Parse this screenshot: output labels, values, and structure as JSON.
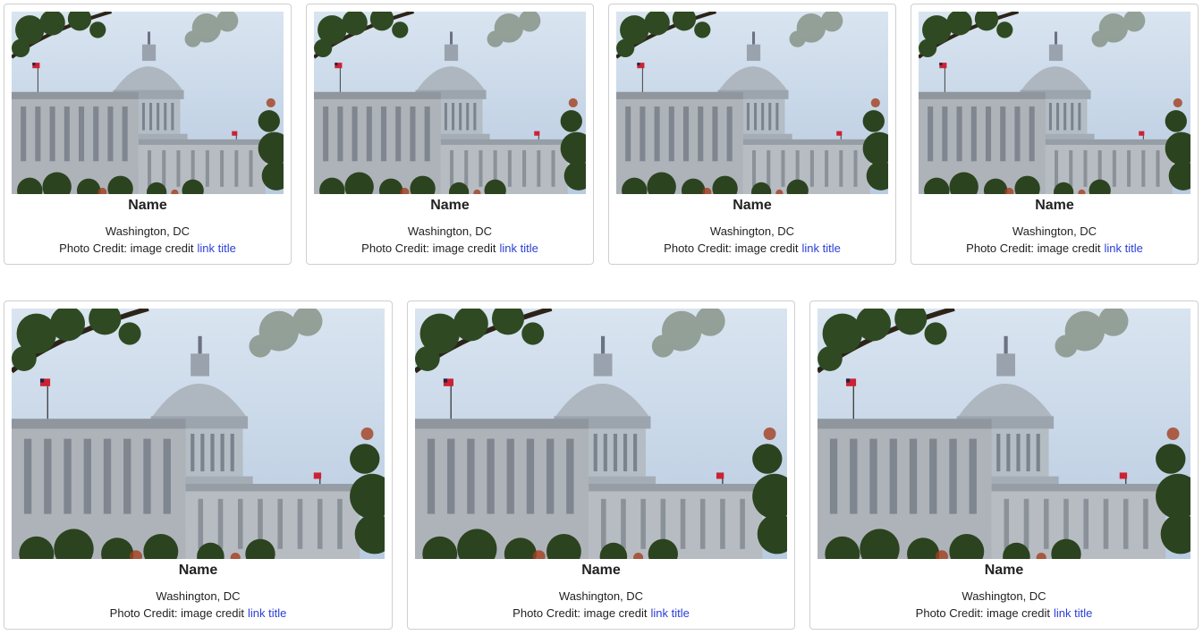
{
  "colors": {
    "link": "#2a3ed6",
    "border": "#cfcfcf",
    "sky": "#c9d9ec"
  },
  "photo": {
    "icon": "capitol-dome-photo"
  },
  "cards": [
    {
      "name": "Name",
      "location": "Washington, DC",
      "credit_label": "Photo Credit: image credit",
      "link_text": "link title"
    },
    {
      "name": "Name",
      "location": "Washington, DC",
      "credit_label": "Photo Credit: image credit",
      "link_text": "link title"
    },
    {
      "name": "Name",
      "location": "Washington, DC",
      "credit_label": "Photo Credit: image credit",
      "link_text": "link title"
    },
    {
      "name": "Name",
      "location": "Washington, DC",
      "credit_label": "Photo Credit: image credit",
      "link_text": "link title"
    },
    {
      "name": "Name",
      "location": "Washington, DC",
      "credit_label": "Photo Credit: image credit",
      "link_text": "link title"
    },
    {
      "name": "Name",
      "location": "Washington, DC",
      "credit_label": "Photo Credit: image credit",
      "link_text": "link title"
    },
    {
      "name": "Name",
      "location": "Washington, DC",
      "credit_label": "Photo Credit: image credit",
      "link_text": "link title"
    }
  ]
}
